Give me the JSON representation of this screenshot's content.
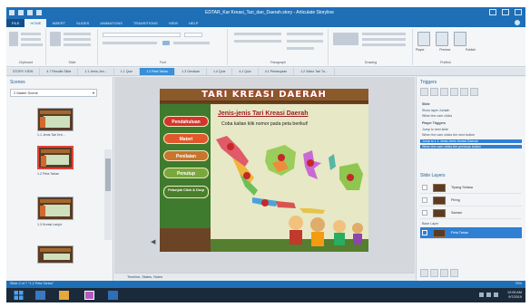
{
  "window": {
    "title": "EDTAR_Kar Kreasi_Tari_dan_Daerah.story - Articulate Storyline"
  },
  "ribbon_tabs": [
    "FILE",
    "HOME",
    "INSERT",
    "SLIDES",
    "ANIMATIONS",
    "TRANSITIONS",
    "VIEW",
    "HELP"
  ],
  "active_ribbon_tab_index": 1,
  "ribbon_groups": [
    "Clipboard",
    "Slide",
    "Font",
    "Paragraph",
    "Drawing",
    "Publish"
  ],
  "publish_labels": [
    "Player",
    "Preview",
    "Publish"
  ],
  "slide_tabs": [
    "STORY VIEW",
    "4.7 Results Slide",
    "1.1 Jenis-Jen...",
    "1.1 Quiz",
    "1.2 Peta Tarian",
    "1.3 Gerakan",
    "1.4 Quiz",
    "4.1 Quiz",
    "4.1 Pertanyaan",
    "1.2 Video Tari Tu..."
  ],
  "active_slide_tab_index": 4,
  "scenes": {
    "title": "Scenes",
    "dropdown": "2 Materi Scene",
    "items": [
      "1.1 Jenis Tari Kre...",
      "1.2 Peta Tarian",
      "1.3 Kreasi Lanjut"
    ],
    "selected_index": 1
  },
  "slide": {
    "banner": "TARI KREASI DAERAH",
    "subtitle": "Jenis-jenis Tari Kreasi Daerah",
    "instruction": "Coba kalian klik nomor pada peta berikut!",
    "menu": [
      "Pendahuluan",
      "Materi",
      "Penilaian",
      "Penutup",
      "Petunjuk Click & Drop"
    ]
  },
  "stage_status": "Timeline, States, Notes",
  "triggers": {
    "title": "Triggers",
    "group": "Slide",
    "lines": [
      "Show layer Jumlah",
      "When the user clicks",
      "Player Triggers",
      "Jump to next slide",
      "When the user clicks the next button",
      "Jump to 1.1 Jenis-Jenis Kreasi Daerah",
      "When the user clicks the previous button"
    ],
    "highlighted_index": 5
  },
  "slide_layers": {
    "title": "Slide Layers",
    "items": [
      "Tiyang Selasa",
      "Piring",
      "Saman"
    ],
    "base_label": "Base Layer",
    "base": "Peta Tarian"
  },
  "status_bar": {
    "left": "Slide 2 of 7 \"1.2 Peta Tarian\"",
    "zoom": "75%"
  },
  "taskbar": {
    "time": "12:05 AM",
    "date": "9/7/2019"
  },
  "colors": {
    "accent": "#1f6fb6",
    "banner": "#8b5a2b",
    "subtitle": "#9e1f25",
    "btn_red": "#d4342b",
    "btn_green": "#7aa73c"
  }
}
